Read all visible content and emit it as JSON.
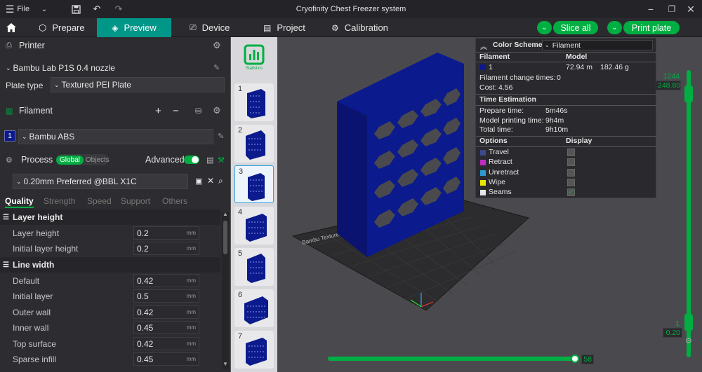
{
  "titlebar": {
    "file_label": "File",
    "title": "Cryofinity Chest Freezer system"
  },
  "tabs": [
    {
      "label": "Prepare"
    },
    {
      "label": "Preview"
    },
    {
      "label": "Device"
    },
    {
      "label": "Project"
    },
    {
      "label": "Calibration"
    }
  ],
  "actions": {
    "slice_all": "Slice all",
    "print_plate": "Print plate"
  },
  "printer": {
    "section_label": "Printer",
    "name": "Bambu Lab P1S 0.4 nozzle",
    "plate_type_label": "Plate type",
    "plate_type": "Textured PEI Plate"
  },
  "filament": {
    "section_label": "Filament",
    "slot": "1",
    "name": "Bambu ABS",
    "color": "#0b1a8c"
  },
  "process": {
    "section_label": "Process",
    "toggle_global": "Global",
    "toggle_objects": "Objects",
    "advanced_label": "Advanced",
    "preset": "0.20mm Preferred @BBL X1C",
    "tabs": [
      "Quality",
      "Strength",
      "Speed",
      "Support",
      "Others"
    ],
    "groups": [
      {
        "title": "Layer height",
        "params": [
          {
            "label": "Layer height",
            "value": "0.2",
            "unit": "mm"
          },
          {
            "label": "Initial layer height",
            "value": "0.2",
            "unit": "mm"
          }
        ]
      },
      {
        "title": "Line width",
        "params": [
          {
            "label": "Default",
            "value": "0.42",
            "unit": "mm"
          },
          {
            "label": "Initial layer",
            "value": "0.5",
            "unit": "mm"
          },
          {
            "label": "Outer wall",
            "value": "0.42",
            "unit": "mm"
          },
          {
            "label": "Inner wall",
            "value": "0.45",
            "unit": "mm"
          },
          {
            "label": "Top surface",
            "value": "0.42",
            "unit": "mm"
          },
          {
            "label": "Sparse infill",
            "value": "0.45",
            "unit": "mm"
          }
        ]
      }
    ]
  },
  "plates": {
    "stats_label": "Statistics",
    "items": [
      {
        "number": "1"
      },
      {
        "number": "2"
      },
      {
        "number": "3"
      },
      {
        "number": "4"
      },
      {
        "number": "5"
      },
      {
        "number": "6"
      },
      {
        "number": "7"
      }
    ]
  },
  "color_scheme": {
    "title": "Color Scheme",
    "mode": "Filament",
    "col_filament": "Filament",
    "col_model": "Model",
    "filament_index": "1",
    "length": "72.94 m",
    "weight": "182.46 g",
    "change_times_label": "Filament change times:",
    "change_times": "0",
    "cost_label": "Cost:",
    "cost": "4.56",
    "time_header": "Time Estimation",
    "prepare_label": "Prepare time:",
    "prepare": "5m46s",
    "model_print_label": "Model printing time:",
    "model_print": "9h4m",
    "total_label": "Total time:",
    "total": "9h10m",
    "options_label": "Options",
    "display_label": "Display",
    "options": [
      {
        "label": "Travel",
        "color": "#3a4a8c",
        "checked": false
      },
      {
        "label": "Retract",
        "color": "#c02cc0",
        "checked": false
      },
      {
        "label": "Unretract",
        "color": "#2f9ad0",
        "checked": false
      },
      {
        "label": "Wipe",
        "color": "#e8e800",
        "checked": false
      },
      {
        "label": "Seams",
        "color": "#e6e6e6",
        "checked": true
      }
    ]
  },
  "sliders": {
    "top_layer": "1244",
    "top_height": "248.80",
    "bottom_layer": "1",
    "bottom_height": "0.20",
    "move_value": "58"
  },
  "plate_label": "Bambu Textured PEI Plate",
  "accent": "#00ae42"
}
